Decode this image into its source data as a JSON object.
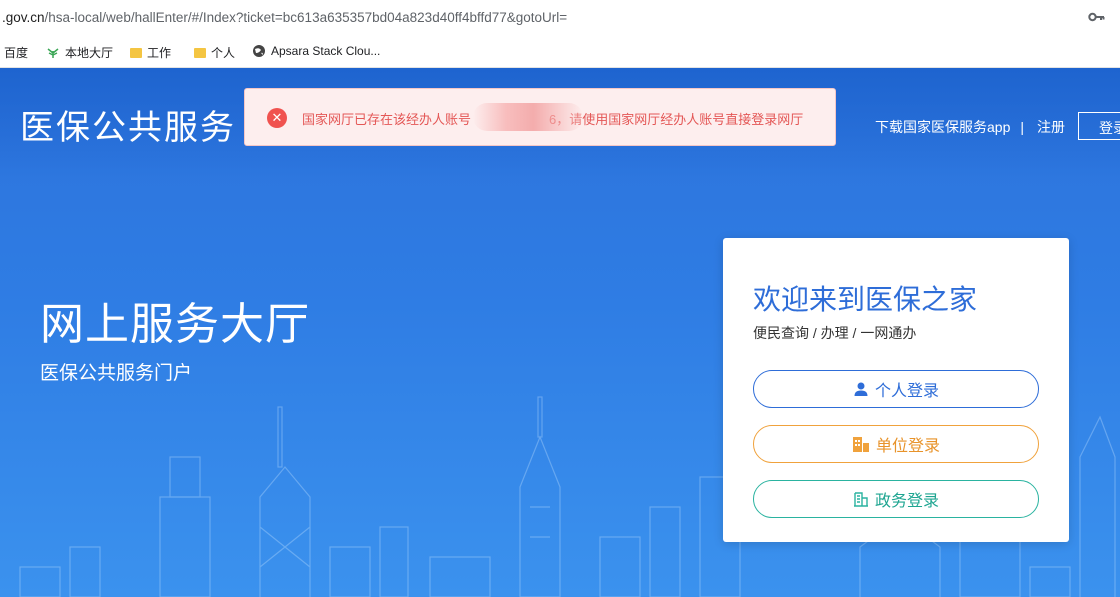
{
  "browser": {
    "url_prefix": ".gov.cn",
    "url_rest": "/hsa-local/web/hallEnter/#/Index?ticket=bc613a635357bd04a823d40ff4bffd77&gotoUrl=",
    "bookmarks": [
      {
        "label": "百度",
        "icon": "baidu-icon"
      },
      {
        "label": "本地大厅",
        "icon": "leaf-icon"
      },
      {
        "label": "工作",
        "icon": "folder-icon"
      },
      {
        "label": "个人",
        "icon": "folder-icon"
      },
      {
        "label": "Apsara Stack Clou...",
        "icon": "globe-icon"
      }
    ]
  },
  "header": {
    "brand": "医保公共服务",
    "download_app": "下载国家医保服务app",
    "separator": "|",
    "register": "注册",
    "login": "登录"
  },
  "toast": {
    "message_start": "国家网厅已存在该经办人账号",
    "message_end": "6，请使用国家网厅经办人账号直接登录网厅",
    "color": "#e45756"
  },
  "hero": {
    "title": "网上服务大厅",
    "subtitle": "医保公共服务门户"
  },
  "login_card": {
    "title": "欢迎来到医保之家",
    "subtitle": "便民查询 / 办理 / 一网通办",
    "personal_label": "个人登录",
    "unit_label": "单位登录",
    "gov_label": "政务登录",
    "colors": {
      "personal": "#2e6dd8",
      "unit": "#f0a23c",
      "gov": "#2ab3a0"
    }
  }
}
